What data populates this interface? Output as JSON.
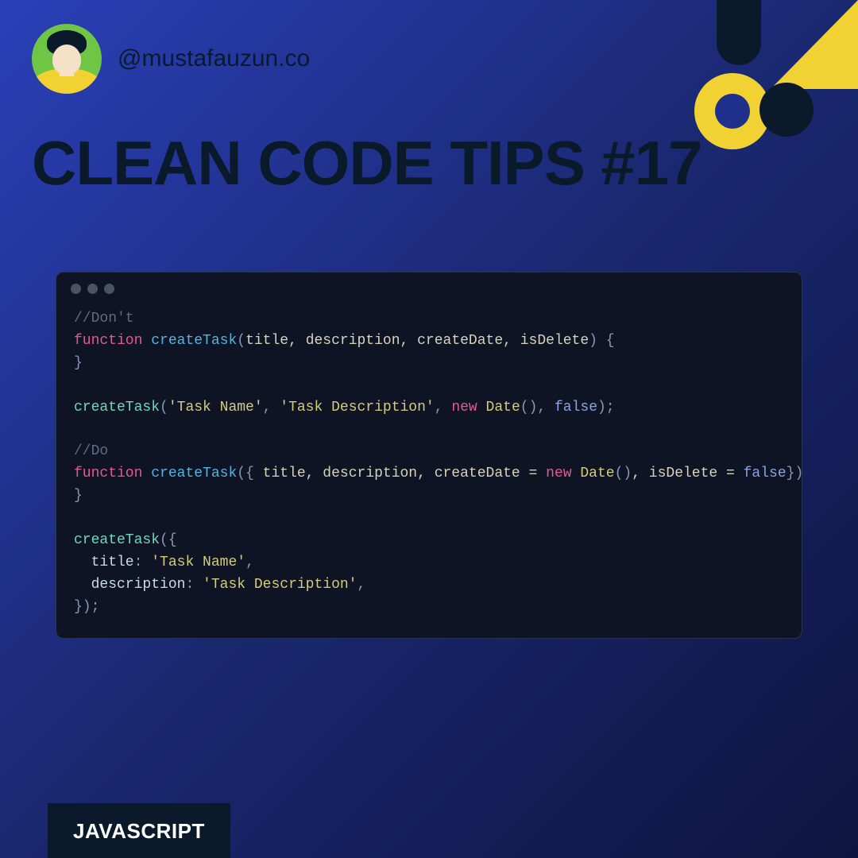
{
  "header": {
    "handle": "@mustafauzun.co"
  },
  "title": "CLEAN CODE TIPS #17",
  "code": {
    "c1": "//Don't",
    "kw_func1": "function",
    "fn1": "createTask",
    "p_open1": "(",
    "params1": "title, description, createDate, isDelete",
    "p_close1": ") {",
    "brace_close1": "}",
    "call1": "createTask",
    "call1_open": "(",
    "str1": "'Task Name'",
    "comma1": ", ",
    "str2": "'Task Description'",
    "comma2": ", ",
    "new1": "new",
    "sp": " ",
    "date1": "Date",
    "dp1": "(), ",
    "false1": "false",
    "call1_close": ");",
    "c2": "//Do",
    "kw_func2": "function",
    "fn2": "createTask",
    "p_open2": "({ ",
    "params2a": "title, description, createDate = ",
    "new2": "new",
    "date2": "Date",
    "dp2": "()",
    "params2b": ", isDelete = ",
    "false2": "false",
    "p_close2": "}) {",
    "brace_close2": "}",
    "call2": "createTask",
    "call2_open": "({",
    "prop_title": "  title",
    "colon1": ": ",
    "str3": "'Task Name'",
    "comma3": ",",
    "prop_desc": "  description",
    "colon2": ": ",
    "str4": "'Task Description'",
    "comma4": ",",
    "call2_close": "});"
  },
  "footer": {
    "tag": "JAVASCRIPT"
  },
  "colors": {
    "accent_yellow": "#f2d233",
    "dark": "#0b1a2a"
  }
}
